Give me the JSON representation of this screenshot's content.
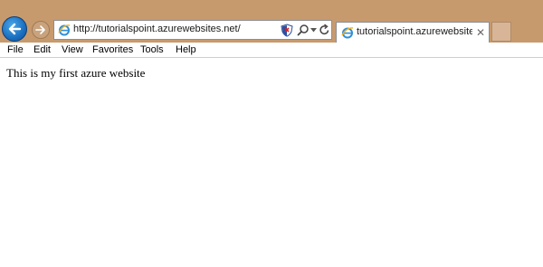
{
  "browser": {
    "address_bar": {
      "url": "http://tutorialspoint.azurewebsites.net/"
    },
    "tab": {
      "title": "tutorialspoint.azurewebsite...",
      "close_glyph": "✕"
    },
    "menu": {
      "items": [
        "File",
        "Edit",
        "View",
        "Favorites",
        "Tools",
        "Help"
      ]
    },
    "icons": {
      "back": "back-arrow-icon",
      "forward": "forward-arrow-icon",
      "site": "ie-logo-icon",
      "shield": "compatibility-shield-icon",
      "search": "search-icon",
      "dropdown": "chevron-down-icon",
      "refresh": "refresh-icon"
    },
    "colors": {
      "title_bar": "#c79a6e",
      "back_button": "#1a6fc0"
    }
  },
  "page": {
    "body_text": "This is my first azure website"
  }
}
